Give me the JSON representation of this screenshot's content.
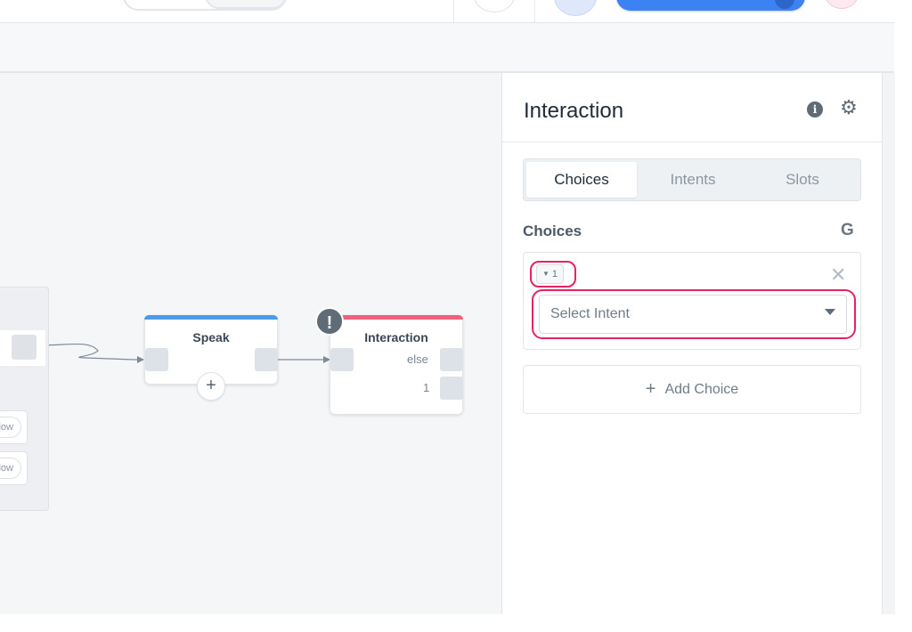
{
  "canvas": {
    "flow_label": "Flow",
    "speak_node": {
      "title": "Speak",
      "add_symbol": "+"
    },
    "interaction_node": {
      "title": "Interaction",
      "warning_symbol": "!",
      "outputs": [
        "else",
        "1"
      ]
    }
  },
  "panel": {
    "title": "Interaction",
    "info_icon_glyph": "i",
    "gear_icon_glyph": "⚙",
    "tabs": [
      "Choices",
      "Intents",
      "Slots"
    ],
    "active_tab": "Choices",
    "choices_label": "Choices",
    "g_icon_glyph": "G",
    "choice": {
      "badge": "1",
      "badge_caret": "▼",
      "close_glyph": "✕",
      "select_placeholder": "Select Intent"
    },
    "add_choice_symbol": "+",
    "add_choice_label": "Add Choice"
  },
  "colors": {
    "speak_accent": "#4a9bea",
    "interaction_accent": "#f0607a",
    "primary_button": "#3d82f2",
    "highlight": "#e5245f"
  }
}
